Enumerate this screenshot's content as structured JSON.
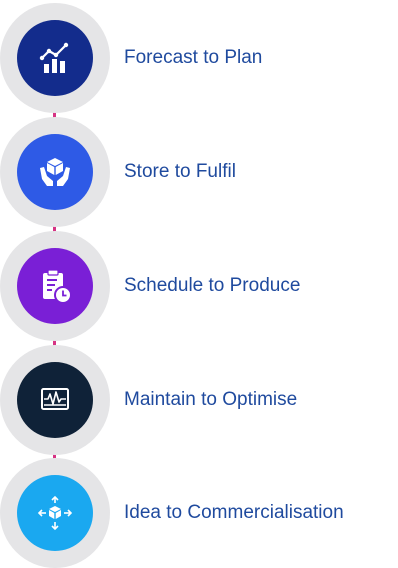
{
  "accent_color": "#d63384",
  "steps": [
    {
      "label": "Forecast to Plan",
      "icon": "chart-growth-icon",
      "circle_color": "#132c8c",
      "text_color": "#1f4a9e"
    },
    {
      "label": "Store to Fulfil",
      "icon": "hands-box-icon",
      "circle_color": "#2e5ae6",
      "text_color": "#1f4a9e"
    },
    {
      "label": "Schedule to Produce",
      "icon": "clipboard-clock-icon",
      "circle_color": "#7a1fd6",
      "text_color": "#1f4a9e"
    },
    {
      "label": "Maintain to Optimise",
      "icon": "monitor-pulse-icon",
      "circle_color": "#0f2238",
      "text_color": "#1f4a9e"
    },
    {
      "label": "Idea to Commercialisation",
      "icon": "cube-arrows-icon",
      "circle_color": "#1aa8f0",
      "text_color": "#1f4a9e"
    }
  ]
}
